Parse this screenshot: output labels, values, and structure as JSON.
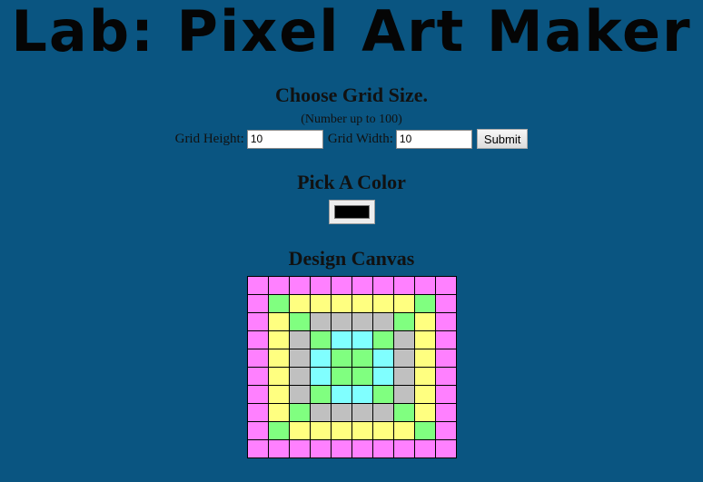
{
  "page": {
    "title": "Lab: Pixel Art Maker",
    "background_color": "#0a5581"
  },
  "grid_size": {
    "heading": "Choose Grid Size.",
    "hint": "(Number up to 100)",
    "height_label": "Grid Height:",
    "height_value": "10",
    "width_label": "Grid Width:",
    "width_value": "10",
    "submit_label": "Submit"
  },
  "color": {
    "heading": "Pick A Color",
    "selected_color": "#000000"
  },
  "canvas": {
    "heading": "Design Canvas",
    "rows": 10,
    "cols": 10,
    "palette": {
      "P": "#ff80ff",
      "G": "#80ff80",
      "Y": "#ffff80",
      "S": "#c0c0c0",
      "C": "#80ffff"
    },
    "cells": [
      "PPPPPPPPPP",
      "PGYYYYYYGP",
      "PYGSSSSGYP",
      "PYSGCCGSYP",
      "PYSCGGCSYP",
      "PYSCGGCSYP",
      "PYSGCCGSYP",
      "PYGSSSSGYP",
      "PGYYYYYYGP",
      "PPPPPPPPPP"
    ]
  }
}
